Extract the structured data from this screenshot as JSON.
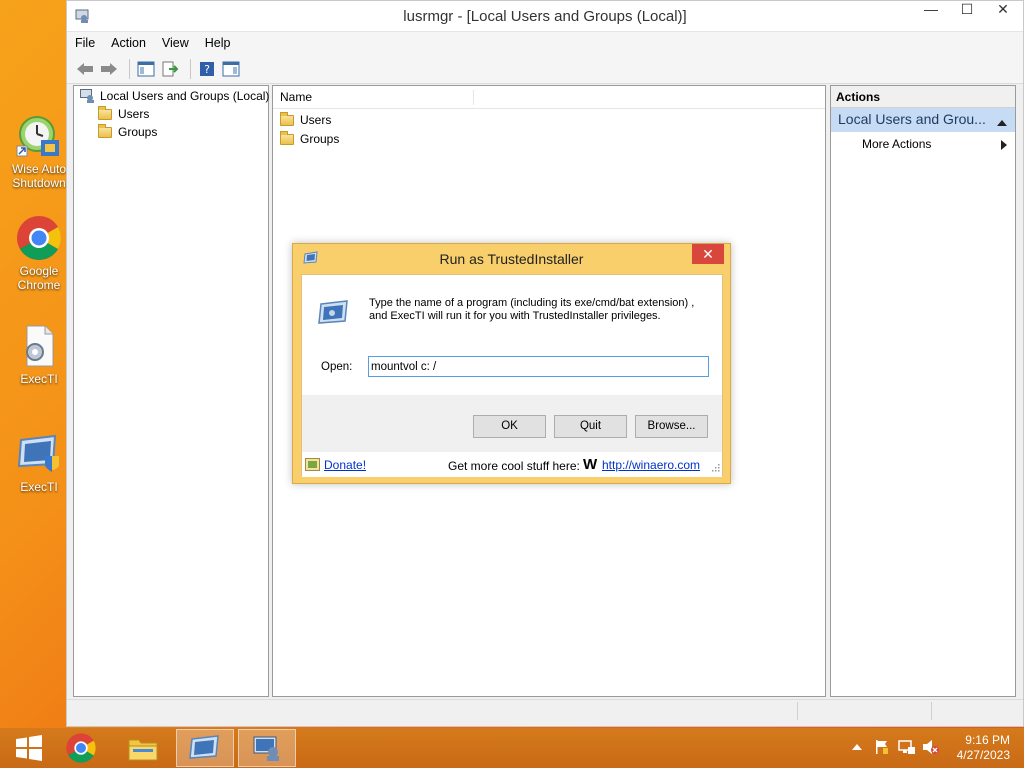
{
  "desktop": {
    "icons": [
      {
        "label_line1": "Wise Auto",
        "label_line2": "Shutdown"
      },
      {
        "label_line1": "Google",
        "label_line2": "Chrome"
      },
      {
        "label_line1": "ExecTI",
        "label_line2": ""
      },
      {
        "label_line1": "ExecTI",
        "label_line2": ""
      }
    ]
  },
  "window": {
    "title": "lusrmgr - [Local Users and Groups (Local)]",
    "controls": {
      "minimize": "—",
      "maximize": "☐",
      "close": "✕"
    },
    "menu": [
      "File",
      "Action",
      "View",
      "Help"
    ]
  },
  "tree": {
    "root": "Local Users and Groups (Local)",
    "children": [
      "Users",
      "Groups"
    ]
  },
  "list": {
    "column_name": "Name",
    "items": [
      "Users",
      "Groups"
    ]
  },
  "actions": {
    "header": "Actions",
    "section": "Local Users and Grou...",
    "more_actions": "More Actions"
  },
  "dialog": {
    "title": "Run as TrustedInstaller",
    "close": "✕",
    "description_line1": "Type the name of a program (including its exe/cmd/bat extension) ,",
    "description_line2": "and ExecTI will run it for you with TrustedInstaller privileges.",
    "open_label": "Open:",
    "open_value": "mountvol c: /",
    "buttons": {
      "ok": "OK",
      "quit": "Quit",
      "browse": "Browse..."
    },
    "donate": "Donate!",
    "more_stuff": "Get more cool stuff here:",
    "winaero_logo": "W",
    "winaero_link": "http://winaero.com"
  },
  "taskbar": {
    "time": "9:16 PM",
    "date": "4/27/2023"
  },
  "colors": {
    "dialog_frame": "#f8cf6b",
    "close_red": "#d9473c",
    "taskbar": "#cc6d17",
    "action_header": "#c6dcf4"
  }
}
